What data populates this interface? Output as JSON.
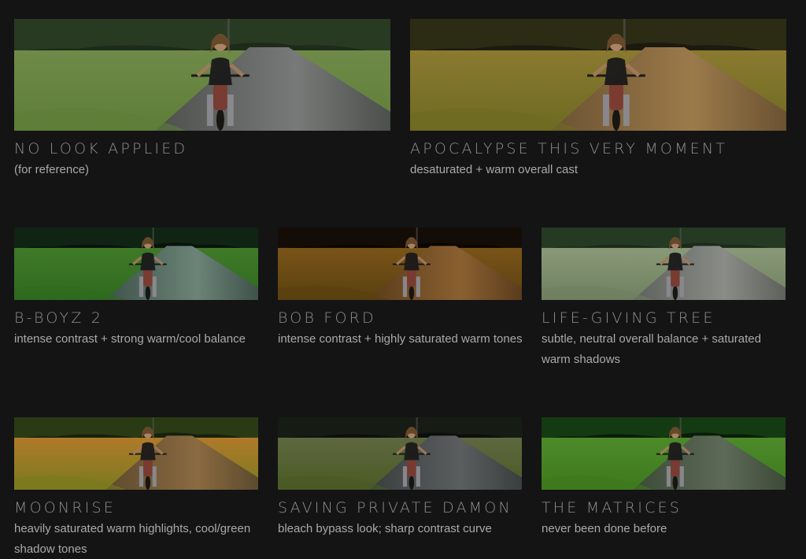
{
  "looks": [
    {
      "id": "no-look",
      "title": "No Look Applied",
      "description": "(for reference)",
      "colors": {
        "sky": "#1e2a1a",
        "trees": "#283a22",
        "field": "#6f8a48",
        "grass": "#5e7e38",
        "road": "#777a78",
        "shade": "#4c4f4c"
      }
    },
    {
      "id": "apocalypse",
      "title": "Apocalypse This Very Moment",
      "description": "desaturated + warm overall cast",
      "colors": {
        "sky": "#1c1a10",
        "trees": "#2c2b14",
        "field": "#8a7a30",
        "grass": "#6e6a22",
        "road": "#9c7a4a",
        "shade": "#6a5232"
      }
    },
    {
      "id": "b-boyz",
      "title": "B-Boyz 2",
      "description": "intense contrast + strong warm/cool balance",
      "colors": {
        "sky": "#0a120c",
        "trees": "#0f2412",
        "field": "#3f7a28",
        "grass": "#2f6a1e",
        "road": "#6c8478",
        "shade": "#3e524a"
      }
    },
    {
      "id": "bob-ford",
      "title": "Bob Ford",
      "description": "intense contrast + highly saturated warm tones",
      "colors": {
        "sky": "#0a0604",
        "trees": "#140c06",
        "field": "#7a5418",
        "grass": "#5a4010",
        "road": "#8a6030",
        "shade": "#5a3c1c"
      }
    },
    {
      "id": "life-giving",
      "title": "Life-Giving Tree",
      "description": "subtle, neutral overall balance + saturated warm shadows",
      "colors": {
        "sky": "#1c2a1c",
        "trees": "#243a22",
        "field": "#8a9a78",
        "grass": "#6e8060",
        "road": "#8a8c88",
        "shade": "#5e605c"
      }
    },
    {
      "id": "moonrise",
      "title": "Moonrise",
      "description": "heavily saturated warm highlights, cool/green shadow tones",
      "colors": {
        "sky": "#16200e",
        "trees": "#2a3a14",
        "field": "#b07a2a",
        "grass": "#7a7a1e",
        "road": "#8a6a40",
        "shade": "#5c4a2e"
      }
    },
    {
      "id": "saving",
      "title": "Saving Private Damon",
      "description": "bleach bypass look; sharp contrast curve",
      "colors": {
        "sky": "#0c0e0c",
        "trees": "#161c14",
        "field": "#5e6840",
        "grass": "#4a5a24",
        "road": "#5a5e5e",
        "shade": "#3a3e3e"
      }
    },
    {
      "id": "matrices",
      "title": "The Matrices",
      "description": "never been done before",
      "colors": {
        "sky": "#0a1c0a",
        "trees": "#143a12",
        "field": "#4c8a2a",
        "grass": "#3e7a1c",
        "road": "#5e6a58",
        "shade": "#3c4a38"
      }
    }
  ]
}
